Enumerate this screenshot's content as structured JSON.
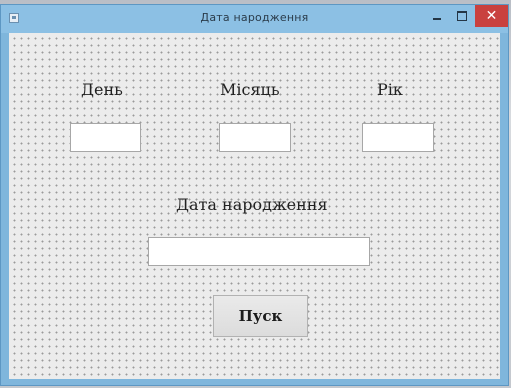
{
  "window": {
    "title": "Дата народження",
    "controls": {
      "minimize": "minimize-icon",
      "maximize": "maximize-icon",
      "close": "close-icon"
    }
  },
  "form": {
    "day_label": "День",
    "month_label": "Місяць",
    "year_label": "Рік",
    "day_value": "",
    "month_value": "",
    "year_value": "",
    "birthdate_label": "Дата народження",
    "birthdate_value": "",
    "run_button": "Пуск"
  },
  "colors": {
    "titlebar": "#8cc0e4",
    "close_button": "#c9413f"
  }
}
